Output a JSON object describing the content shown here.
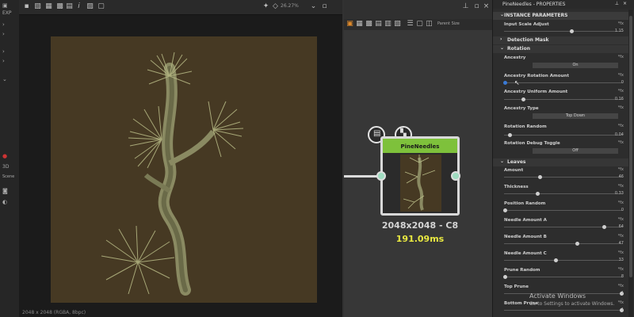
{
  "left_strip": {
    "label_exp": "EXP",
    "label_3d": "3D",
    "label_scene": "Scene"
  },
  "viewport": {
    "zoom": "26.27%",
    "status": "2048 x 2048 (RGBA, 8bpc)"
  },
  "graph": {
    "parent_size_label": "Parent Size",
    "node": {
      "title": "PineNeedles",
      "size_text": "2048x2048 - C8",
      "time_text": "191.09ms"
    }
  },
  "properties": {
    "title": "PineNeedles - PROPERTIES",
    "instance_section": "INSTANCE PARAMETERS",
    "input_scale_label": "Input Scale Adjust",
    "input_scale_value": "1.15",
    "detection_mask_label": "Detection Mask",
    "rotation_label": "Rotation",
    "ancestry_label": "Ancestry",
    "ancestry_value": "On",
    "ancestry_rotation_label": "Ancestry Rotation Amount",
    "ancestry_rotation_value": "0",
    "ancestry_uniform_label": "Ancestry Uniform Amount",
    "ancestry_uniform_value": "0.16",
    "ancestry_type_label": "Ancestry Type",
    "ancestry_type_value": "Top Down",
    "rotation_random_label": "Rotation Random",
    "rotation_random_value": "0.04",
    "rotation_debug_label": "Rotation Debug Toggle",
    "rotation_debug_value": "Off",
    "leaves_label": "Leaves",
    "amount_label": "Amount",
    "amount_value": "46",
    "thickness_label": "Thickness",
    "thickness_value": "0.33",
    "position_random_label": "Position Random",
    "position_random_value": "0",
    "needle_a_label": "Needle Amount A",
    "needle_a_value": "64",
    "needle_b_label": "Needle Amount B",
    "needle_b_value": "47",
    "needle_c_label": "Needle Amount C",
    "needle_c_value": "33",
    "prune_random_label": "Prune Random",
    "prune_random_value": "8",
    "top_prune_label": "Top Prune",
    "top_prune_value": "1",
    "bottom_prune_label": "Bottom Prune",
    "bottom_prune_value": "1",
    "fx_label": "*fx"
  },
  "watermark": {
    "line1": "Activate Windows",
    "line2": "Go to Settings to activate Windows."
  },
  "colors": {
    "node_header": "#7ec13b",
    "time_text": "#e8e841",
    "texture_bg": "#463923"
  }
}
